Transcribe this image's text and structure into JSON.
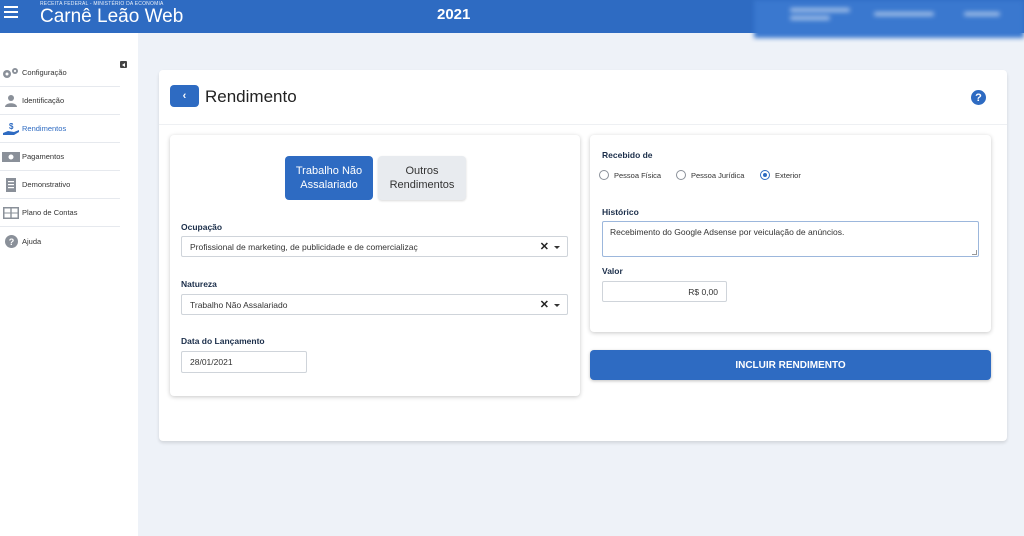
{
  "header": {
    "org": "RECEITA FEDERAL - MINISTÉRIO DA ECONOMIA",
    "app_title": "Carnê Leão Web",
    "year": "2021"
  },
  "sidebar": {
    "items": [
      {
        "label": "Configuração",
        "icon": "gears-icon"
      },
      {
        "label": "Identificação",
        "icon": "user-icon"
      },
      {
        "label": "Rendimentos",
        "icon": "hand-money-icon"
      },
      {
        "label": "Pagamentos",
        "icon": "banknote-icon"
      },
      {
        "label": "Demonstrativo",
        "icon": "document-icon"
      },
      {
        "label": "Plano de Contas",
        "icon": "table-icon"
      },
      {
        "label": "Ajuda",
        "icon": "help-circle-icon"
      }
    ],
    "active": "Rendimentos"
  },
  "page": {
    "back_label": "‹",
    "title": "Rendimento",
    "help_label": "?"
  },
  "form": {
    "tabs": [
      {
        "label": "Trabalho Não Assalariado",
        "active": true
      },
      {
        "label": "Outros Rendimentos",
        "active": false
      }
    ],
    "ocupacao": {
      "label": "Ocupação",
      "value": "Profissional de marketing, de publicidade e de comercializaç"
    },
    "natureza": {
      "label": "Natureza",
      "value": "Trabalho Não Assalariado"
    },
    "data_lancamento": {
      "label": "Data do Lançamento",
      "value": "28/01/2021"
    },
    "recebido_de": {
      "label": "Recebido de",
      "options": [
        "Pessoa Física",
        "Pessoa Jurídica",
        "Exterior"
      ],
      "selected": "Exterior"
    },
    "historico": {
      "label": "Histórico",
      "value": "Recebimento do Google Adsense por veiculação de anúncios."
    },
    "valor": {
      "label": "Valor",
      "value": "R$ 0,00"
    },
    "clear_symbol": "✕",
    "submit_label": "INCLUIR RENDIMENTO"
  },
  "colors": {
    "primary": "#2e6bc2",
    "background": "#eef2f8"
  }
}
